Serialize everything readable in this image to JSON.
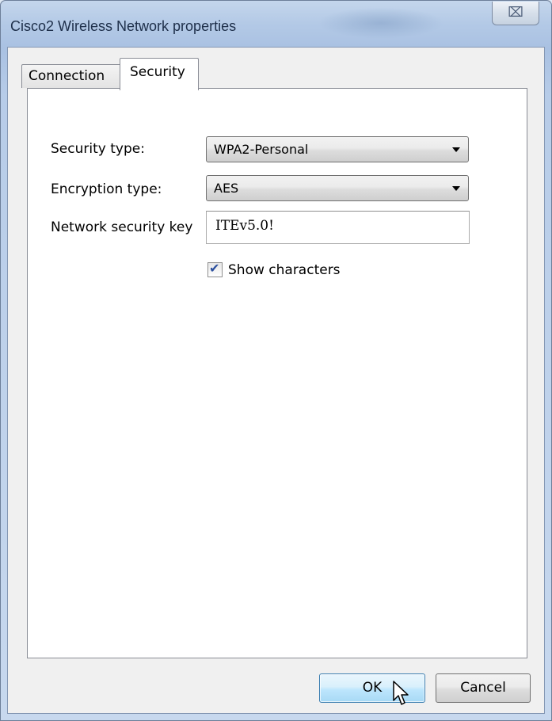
{
  "window": {
    "title": "Cisco2 Wireless Network properties",
    "close_glyph": "⌧"
  },
  "tabs": [
    {
      "label": "Connection",
      "active": false
    },
    {
      "label": "Security",
      "active": true
    }
  ],
  "security": {
    "security_type_label": "Security type:",
    "security_type_value": "WPA2-Personal",
    "encryption_type_label": "Encryption type:",
    "encryption_type_value": "AES",
    "key_label": "Network security key",
    "key_value": "ITEv5.0!",
    "show_characters_label": "Show characters",
    "show_characters_checked": true,
    "check_glyph": "✔"
  },
  "buttons": {
    "ok_label": "OK",
    "cancel_label": "Cancel"
  },
  "colors": {
    "accent": "#3c7fb1",
    "checkmark": "#2b4f9e"
  },
  "icons": [
    "close-icon",
    "dropdown-arrow-icon",
    "checkmark-icon",
    "mouse-cursor-icon"
  ]
}
